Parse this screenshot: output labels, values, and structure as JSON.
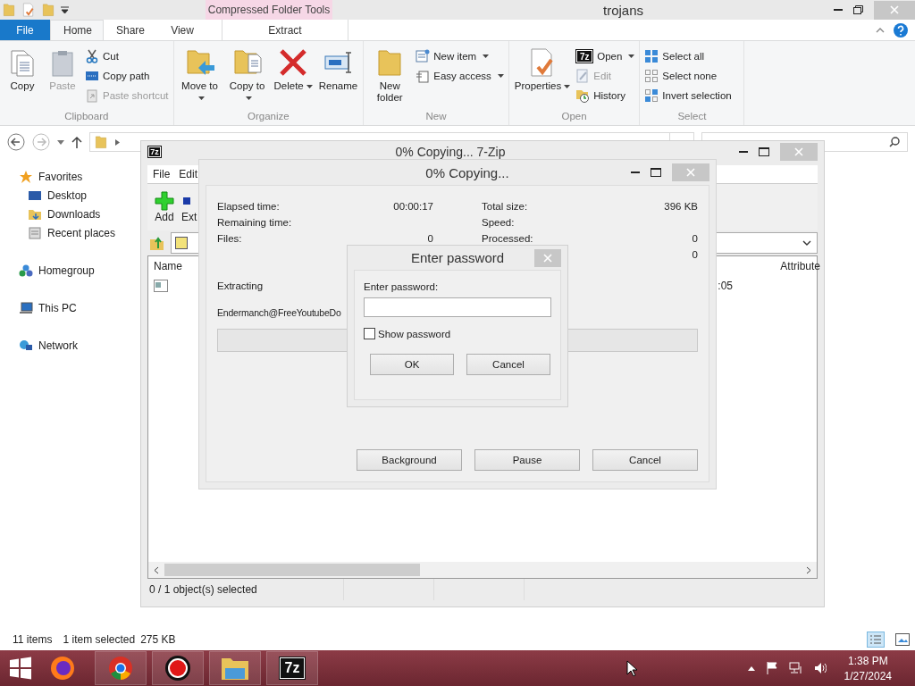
{
  "explorer": {
    "title": "trojans",
    "context_group": "Compressed Folder Tools",
    "tabs": [
      {
        "label": "File",
        "kind": "file",
        "selected": false
      },
      {
        "label": "Home",
        "kind": "tab",
        "selected": true
      },
      {
        "label": "Share",
        "kind": "tab",
        "selected": false
      },
      {
        "label": "View",
        "kind": "tab",
        "selected": false
      },
      {
        "label": "Extract",
        "kind": "context",
        "selected": false
      }
    ],
    "ribbon": [
      {
        "label": "Clipboard",
        "columns": [
          {
            "kind": "large",
            "items": [
              {
                "label": "Copy",
                "disabled": false,
                "dropdown": false
              }
            ]
          },
          {
            "kind": "large",
            "items": [
              {
                "label": "Paste",
                "disabled": true,
                "dropdown": false
              }
            ]
          },
          {
            "kind": "stack",
            "items": [
              {
                "label": "Cut",
                "disabled": false,
                "dropdown": false
              },
              {
                "label": "Copy path",
                "disabled": false,
                "dropdown": false
              },
              {
                "label": "Paste shortcut",
                "disabled": true,
                "dropdown": false
              }
            ]
          }
        ]
      },
      {
        "label": "Organize",
        "columns": [
          {
            "kind": "large",
            "items": [
              {
                "label": "Move to",
                "disabled": false,
                "dropdown": true
              }
            ]
          },
          {
            "kind": "large",
            "items": [
              {
                "label": "Copy to",
                "disabled": false,
                "dropdown": true
              }
            ]
          },
          {
            "kind": "large",
            "items": [
              {
                "label": "Delete",
                "disabled": false,
                "dropdown": true
              }
            ]
          },
          {
            "kind": "large",
            "items": [
              {
                "label": "Rename",
                "disabled": false,
                "dropdown": false
              }
            ]
          }
        ]
      },
      {
        "label": "New",
        "columns": [
          {
            "kind": "large",
            "items": [
              {
                "label": "New folder",
                "disabled": false,
                "dropdown": false
              }
            ]
          },
          {
            "kind": "stack",
            "items": [
              {
                "label": "New item",
                "disabled": false,
                "dropdown": true
              },
              {
                "label": "Easy access",
                "disabled": false,
                "dropdown": true
              }
            ]
          }
        ]
      },
      {
        "label": "Open",
        "columns": [
          {
            "kind": "large",
            "items": [
              {
                "label": "Properties",
                "disabled": false,
                "dropdown": true
              }
            ]
          },
          {
            "kind": "stack",
            "items": [
              {
                "label": "Open",
                "icon_text": "7z",
                "disabled": false,
                "dropdown": true
              },
              {
                "label": "Edit",
                "disabled": true,
                "dropdown": false
              },
              {
                "label": "History",
                "disabled": false,
                "dropdown": false
              }
            ]
          }
        ]
      },
      {
        "label": "Select",
        "columns": [
          {
            "kind": "stack",
            "items": [
              {
                "label": "Select all",
                "disabled": false,
                "dropdown": false
              },
              {
                "label": "Select none",
                "disabled": false,
                "dropdown": false
              },
              {
                "label": "Invert selection",
                "disabled": false,
                "dropdown": false
              }
            ]
          }
        ]
      }
    ],
    "nav": [
      {
        "label": "Favorites",
        "children": [
          {
            "label": "Desktop"
          },
          {
            "label": "Downloads"
          },
          {
            "label": "Recent places"
          }
        ]
      },
      {
        "label": "Homegroup"
      },
      {
        "label": "This PC"
      },
      {
        "label": "Network"
      }
    ],
    "status": [
      "11 items",
      "1 item selected",
      "275 KB"
    ]
  },
  "archive_window": {
    "title": "0% Copying... 7-Zip",
    "icon_text": "7z",
    "menu": [
      "File",
      "Edit"
    ],
    "toolbar": [
      "Add",
      "Ext"
    ],
    "columns": [
      "Name",
      "Attribute"
    ],
    "row_cell": ":05",
    "status": "0 / 1 object(s) selected"
  },
  "progress_dialog": {
    "title": "0% Copying...",
    "left_stats": [
      {
        "label": "Elapsed time:",
        "value": "00:00:17"
      },
      {
        "label": "Remaining time:"
      },
      {
        "label": "Files:",
        "value": "0"
      }
    ],
    "right_stats": [
      {
        "label": "Total size:",
        "value": "396 KB"
      },
      {
        "label": "Speed:"
      },
      {
        "label": "Processed:",
        "value": "0"
      },
      {
        "value": "0"
      }
    ],
    "operation": "Extracting",
    "file": "Endermanch@FreeYoutubeDo",
    "level": 0,
    "buttons": [
      "Background",
      "Pause",
      "Cancel"
    ]
  },
  "password_dialog": {
    "title": "Enter password",
    "label": "Enter password:",
    "show_password": {
      "label": "Show password",
      "checked": false
    },
    "buttons": [
      "OK",
      "Cancel"
    ]
  },
  "taskbar": {
    "apps": [
      {
        "kind": "firefox"
      },
      {
        "kind": "chrome"
      },
      {
        "kind": "recorder"
      },
      {
        "kind": "explorer"
      },
      {
        "kind": "badge",
        "icon_text": "7z"
      }
    ],
    "time": "1:38 PM",
    "date": "1/27/2024"
  }
}
